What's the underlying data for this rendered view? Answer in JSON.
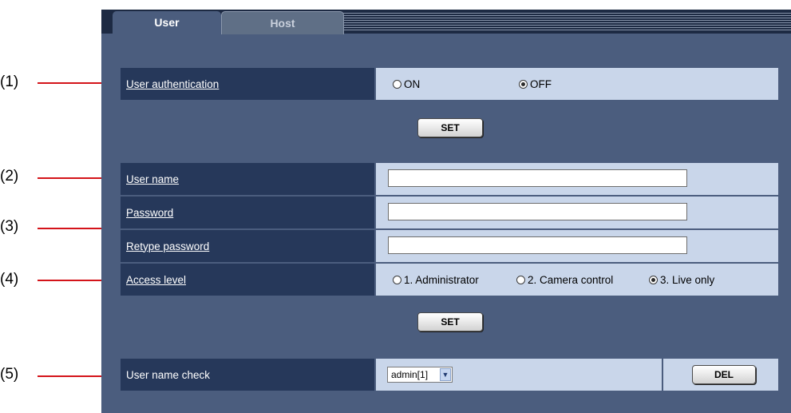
{
  "tabs": [
    {
      "label": "User",
      "active": true
    },
    {
      "label": "Host",
      "active": false
    }
  ],
  "callouts": [
    "(1)",
    "(2)",
    "(3)",
    "(4)",
    "(5)"
  ],
  "user_auth": {
    "label": "User authentication",
    "options": [
      {
        "label": "ON",
        "selected": false
      },
      {
        "label": "OFF",
        "selected": true
      }
    ],
    "set_label": "SET"
  },
  "user_form": {
    "user_name_label": "User name",
    "user_name_value": "",
    "password_label": "Password",
    "password_value": "",
    "retype_label": "Retype password",
    "retype_value": "",
    "access_label": "Access level",
    "access_options": [
      {
        "label": "1. Administrator",
        "selected": false
      },
      {
        "label": "2. Camera control",
        "selected": false
      },
      {
        "label": "3. Live only",
        "selected": true
      }
    ],
    "set_label": "SET"
  },
  "user_check": {
    "label": "User name check",
    "selected": "admin[1]",
    "del_label": "DEL"
  },
  "colors": {
    "panel": "#4b5d7e",
    "label_cell": "#26385a",
    "value_cell": "#c9d6ea",
    "callout_line": "#d4141a"
  }
}
